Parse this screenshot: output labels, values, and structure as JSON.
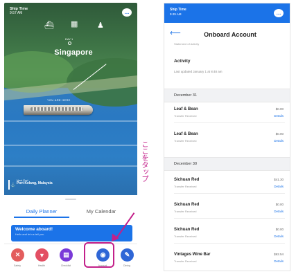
{
  "left": {
    "status": {
      "carrier": "Ship Time",
      "time": "9:57 AM"
    },
    "day_label": "DAY 1",
    "destination": "Singapore",
    "ship_caption": "YOU ARE HERE",
    "next_port": {
      "label": "Next Port",
      "name": "Port Kelang, Malaysia"
    },
    "tabs": [
      {
        "label": "Daily Planner"
      },
      {
        "label": "My Calendar"
      }
    ],
    "welcome_card": {
      "title": "Welcome aboard!",
      "subtitle": "Hello and let us tell you"
    },
    "dock": [
      {
        "label": "Safety",
        "icon": "safety-icon",
        "color": "#e35d5d"
      },
      {
        "label": "Health",
        "icon": "health-icon",
        "color": "#e34f63"
      },
      {
        "label": "Checklist",
        "icon": "checklist-icon",
        "color": "#7a3ad8"
      },
      {
        "label": "Account",
        "icon": "account-icon",
        "color": "#2f66d6"
      },
      {
        "label": "Dining",
        "icon": "dining-icon",
        "color": "#2f66d6"
      }
    ],
    "annotation_note": "ここをタップ",
    "annotation_color": "#c3208a"
  },
  "right": {
    "status": {
      "carrier": "Ship Time",
      "time": "9:49 AM"
    },
    "title": "Onboard Account",
    "subtitle": "Statement of Activity",
    "activity_heading": "Activity",
    "updated": "Last updated January 1 at 8:48 am",
    "sections": [
      {
        "date": "December 31",
        "items": [
          {
            "name": "Leaf & Bean",
            "sub": "Transfer Received",
            "amount": "$0.00",
            "details": "Details"
          },
          {
            "name": "Leaf & Bean",
            "sub": "Transfer Received",
            "amount": "$0.00",
            "details": "Details"
          }
        ]
      },
      {
        "date": "December 30",
        "items": [
          {
            "name": "Sichuan Red",
            "sub": "Transfer Received",
            "amount": "$41.30",
            "details": "Details"
          },
          {
            "name": "Sichuan Red",
            "sub": "Transfer Received",
            "amount": "$0.00",
            "details": "Details"
          },
          {
            "name": "Sichuan Red",
            "sub": "Transfer Received",
            "amount": "$0.00",
            "details": "Details"
          },
          {
            "name": "Vintages Wine Bar",
            "sub": "Transfer Received",
            "amount": "$62.54",
            "details": "Details"
          }
        ]
      }
    ],
    "accent": "#1b73e8"
  }
}
